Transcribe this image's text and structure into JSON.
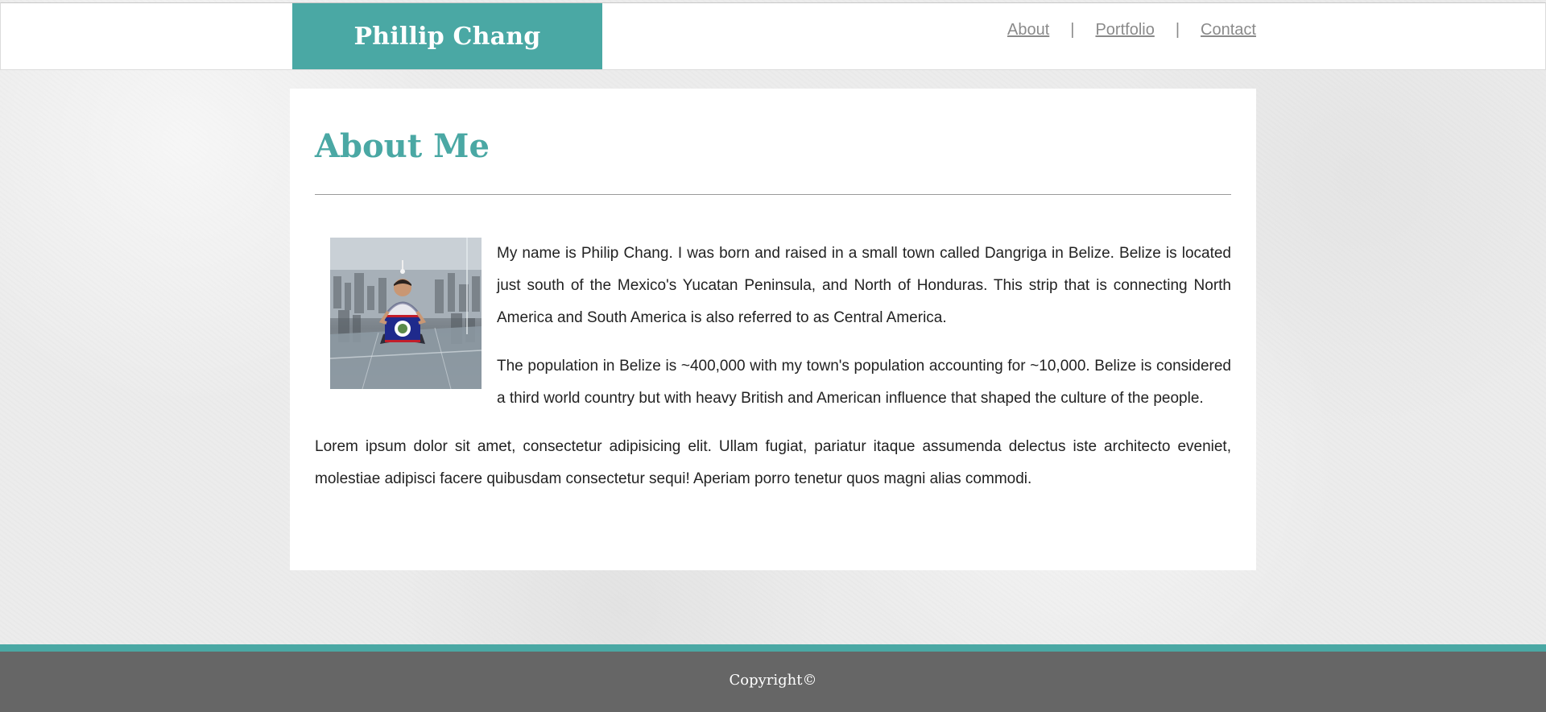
{
  "header": {
    "brand_name": "Phillip Chang",
    "brand_color": "#4aa8a4",
    "nav": {
      "items": [
        {
          "label": "About"
        },
        {
          "label": "Portfolio"
        },
        {
          "label": "Contact"
        }
      ],
      "separator": "|"
    }
  },
  "main": {
    "title": "About Me",
    "accent_color": "#4aa8a4",
    "photo": {
      "icon": "profile-photo"
    },
    "paragraphs": [
      "My name is Philip Chang. I was born and raised in a small town called Dangriga in Belize. Belize is located just south of the Mexico's Yucatan Peninsula, and North of Honduras. This strip that is connecting North America and South America is also referred to as Central America.",
      "The population in Belize is ~400,000 with my town's population accounting for ~10,000. Belize is considered a third world country but with heavy British and American influence that shaped the culture of the people.",
      "Lorem ipsum dolor sit amet, consectetur adipisicing elit. Ullam fugiat, pariatur itaque assumenda delectus iste architecto eveniet, molestiae adipisci facere quibusdam consectetur sequi! Aperiam porro tenetur quos magni alias commodi."
    ]
  },
  "footer": {
    "copyright": "Copyright©",
    "background_color": "#666666",
    "stripe_color": "#4aa8a4"
  }
}
